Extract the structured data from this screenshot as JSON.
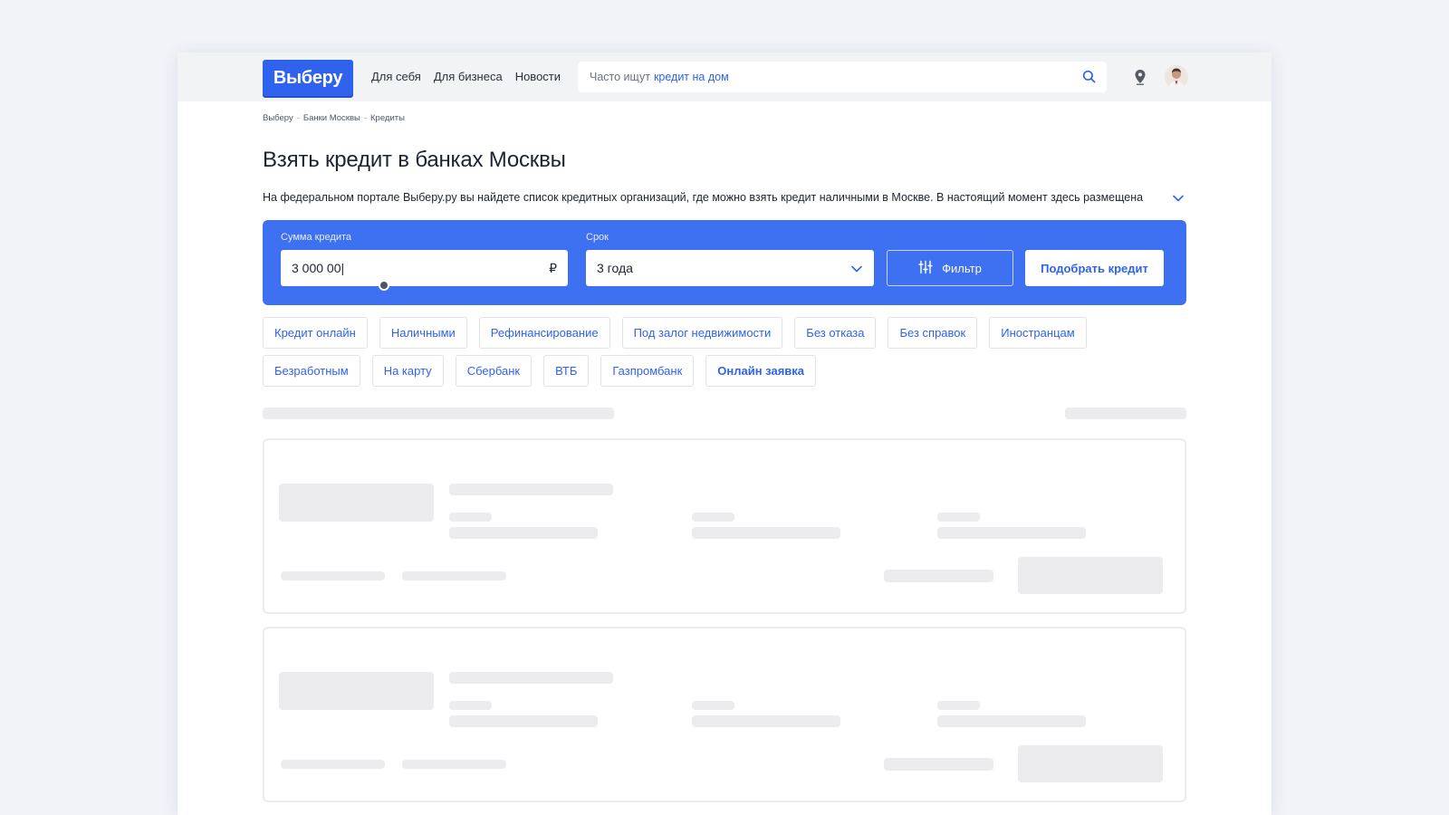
{
  "header": {
    "logo": "Выберу",
    "nav": [
      "Для себя",
      "Для бизнеса",
      "Новости"
    ],
    "search_hint": "Часто ищут",
    "search_hint_link": "кредит на дом"
  },
  "breadcrumb": [
    "Выберу",
    "Банки Москвы",
    "Кредиты"
  ],
  "breadcrumb_sep": "-",
  "page_title": "Взять кредит в банках Москвы",
  "description": "На федеральном портале Выберу.ру вы найдете список кредитных организаций, где можно взять кредит наличными в Москве. В настоящий момент здесь размещена",
  "calculator": {
    "amount_label": "Сумма кредита",
    "amount_value": "3 000 00|",
    "currency": "₽",
    "term_label": "Срок",
    "term_value": "3 года",
    "filter_label": "Фильтр",
    "submit_label": "Подобрать кредит"
  },
  "chips_row1": [
    "Кредит онлайн",
    "Наличными",
    "Рефинансирование",
    "Под залог недвижимости",
    "Без отказа",
    "Без справок",
    "Иностранцам"
  ],
  "chips_row2": [
    "Безработным",
    "На карту",
    "Сбербанк",
    "ВТБ",
    "Газпромбанк",
    "Онлайн заявка"
  ],
  "colors": {
    "accent": "#2f63ee",
    "panel": "#3e70f2",
    "skeleton": "#ececee"
  },
  "icons": [
    "search-icon",
    "location-pin-icon",
    "avatar",
    "chevron-down-icon",
    "filter-sliders-icon"
  ]
}
